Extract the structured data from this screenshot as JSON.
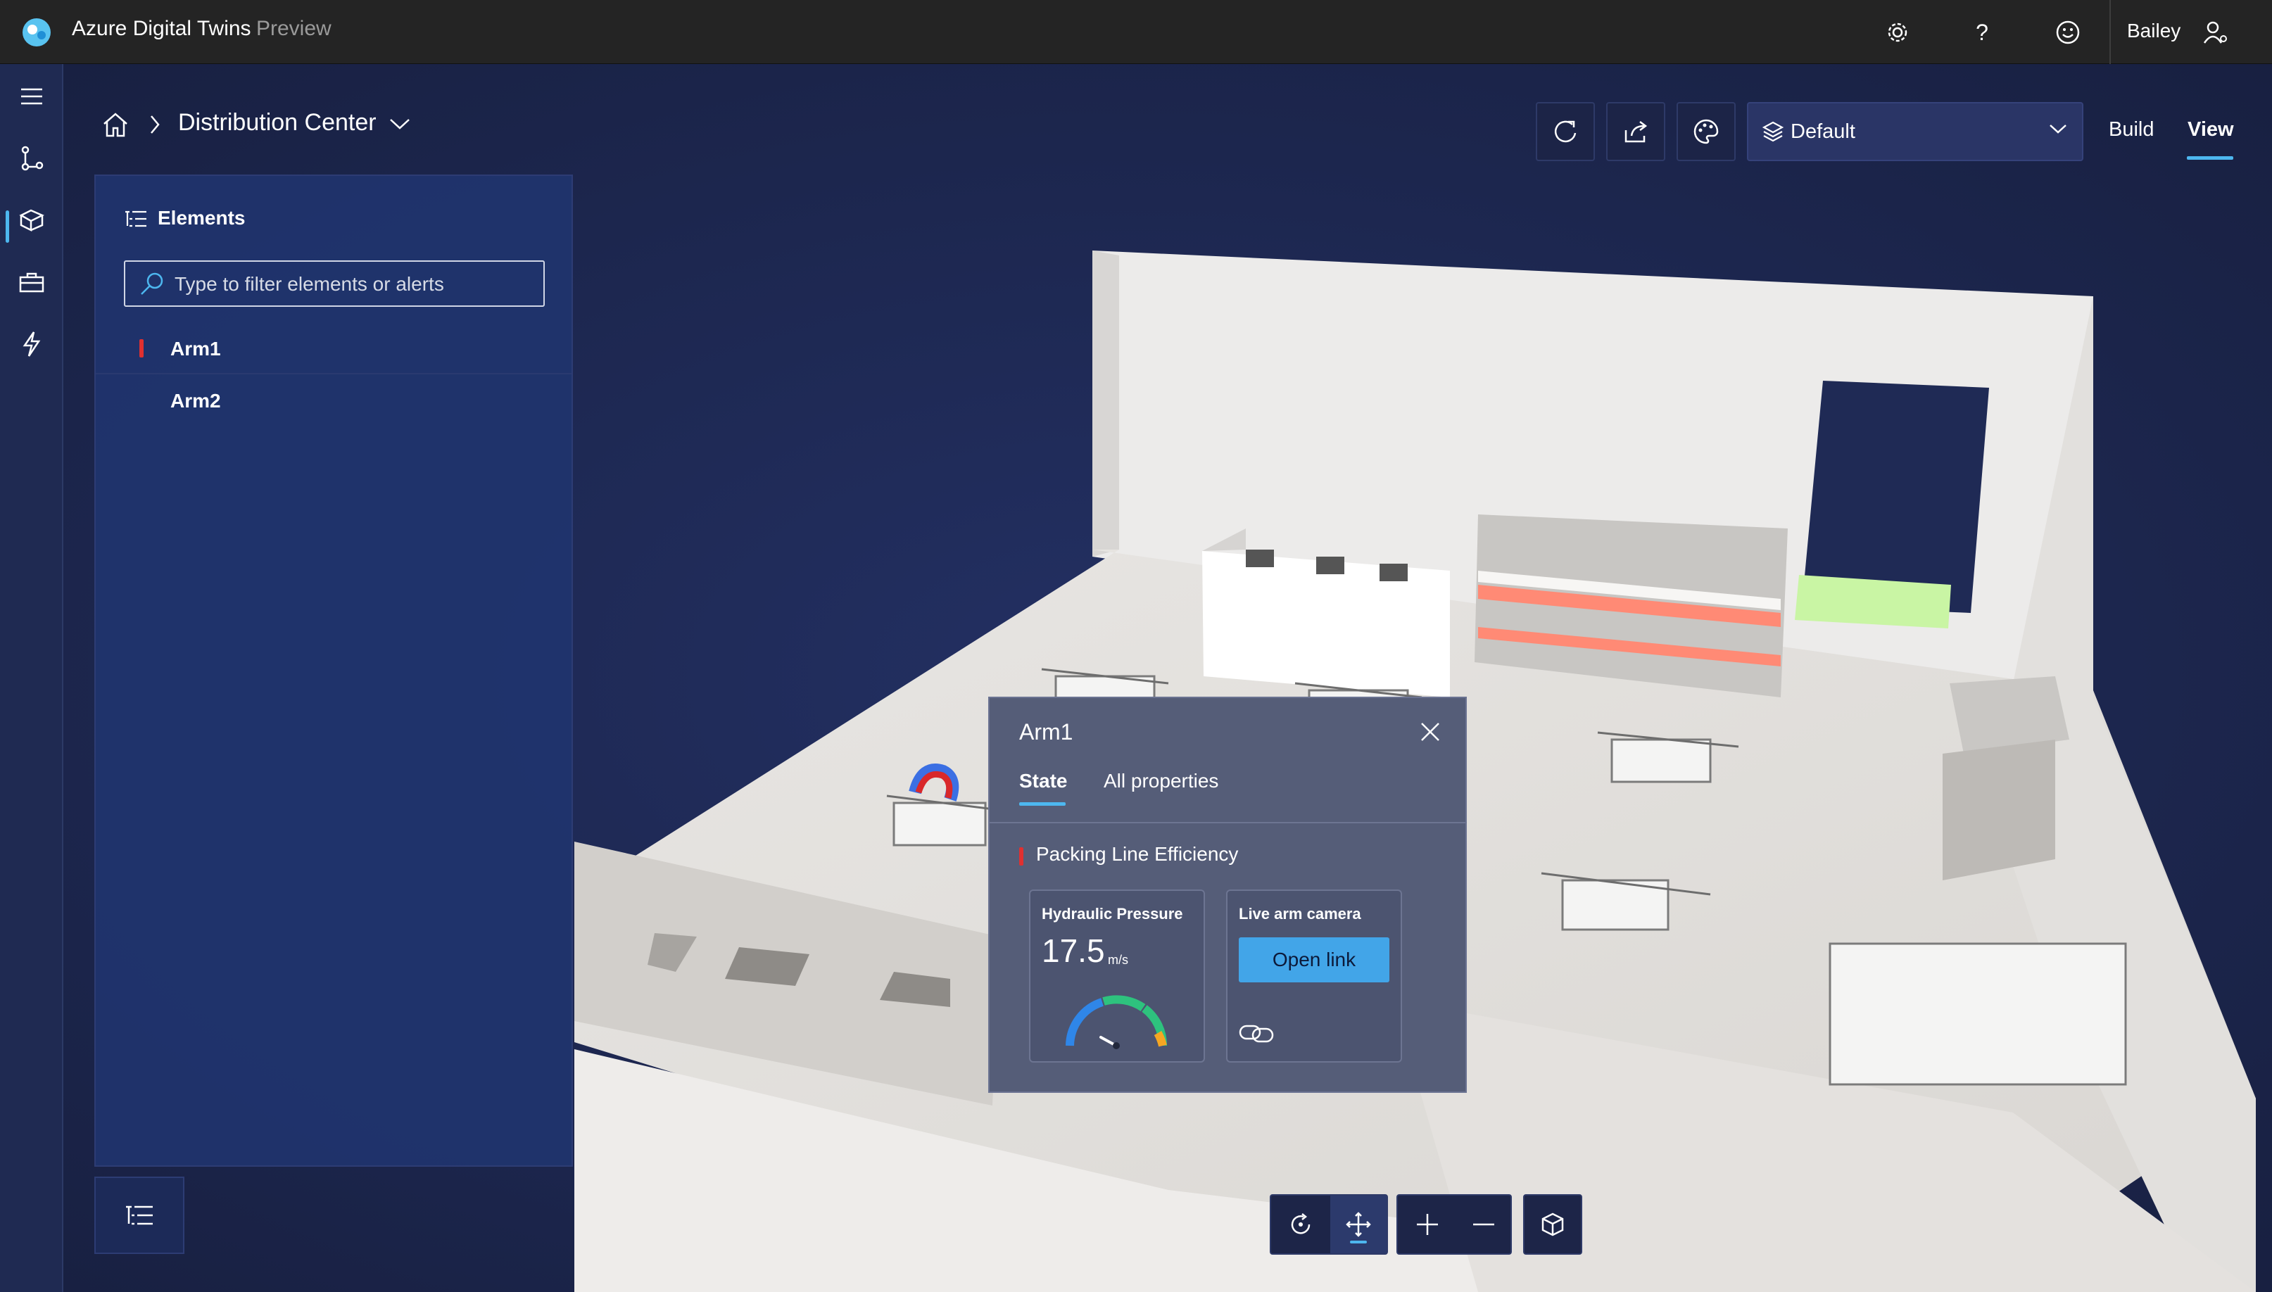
{
  "app": {
    "title": "Azure Digital Twins",
    "badge": "Preview"
  },
  "user": {
    "name": "Bailey"
  },
  "topbar_icons": [
    "gear-icon",
    "help-icon",
    "feedback-smile-icon",
    "user-settings-icon"
  ],
  "rail": {
    "items": [
      "menu-icon",
      "graph-icon",
      "3d-scenes-icon",
      "toolbox-icon",
      "lightning-icon"
    ],
    "active_index": 2
  },
  "breadcrumb": {
    "scene_name": "Distribution Center"
  },
  "header_tools": [
    "refresh-icon",
    "share-icon",
    "theme-palette-icon"
  ],
  "layers": {
    "selected": "Default"
  },
  "modes": {
    "build": "Build",
    "view": "View",
    "active": "View"
  },
  "elements_panel": {
    "title": "Elements",
    "search_placeholder": "Type to filter elements or alerts",
    "items": [
      {
        "label": "Arm1",
        "alert": true
      },
      {
        "label": "Arm2",
        "alert": false
      }
    ]
  },
  "popup": {
    "title": "Arm1",
    "tabs": [
      "State",
      "All properties"
    ],
    "active_tab": "State",
    "section": "Packing Line Efficiency",
    "gauge_widget": {
      "title": "Hydraulic Pressure",
      "value": "17.5",
      "unit": "m/s",
      "needle_fraction": 0.3
    },
    "link_widget": {
      "title": "Live arm camera",
      "button": "Open link"
    }
  },
  "bottom_toolbar": [
    "orbit-icon",
    "pan-move-icon",
    "zoom-in-icon",
    "zoom-out-icon",
    "reset-camera-cube-icon"
  ],
  "colors": {
    "accent": "#4db7ef",
    "alert": "#e03030",
    "background": "#1b2346",
    "topbar": "#242424"
  }
}
